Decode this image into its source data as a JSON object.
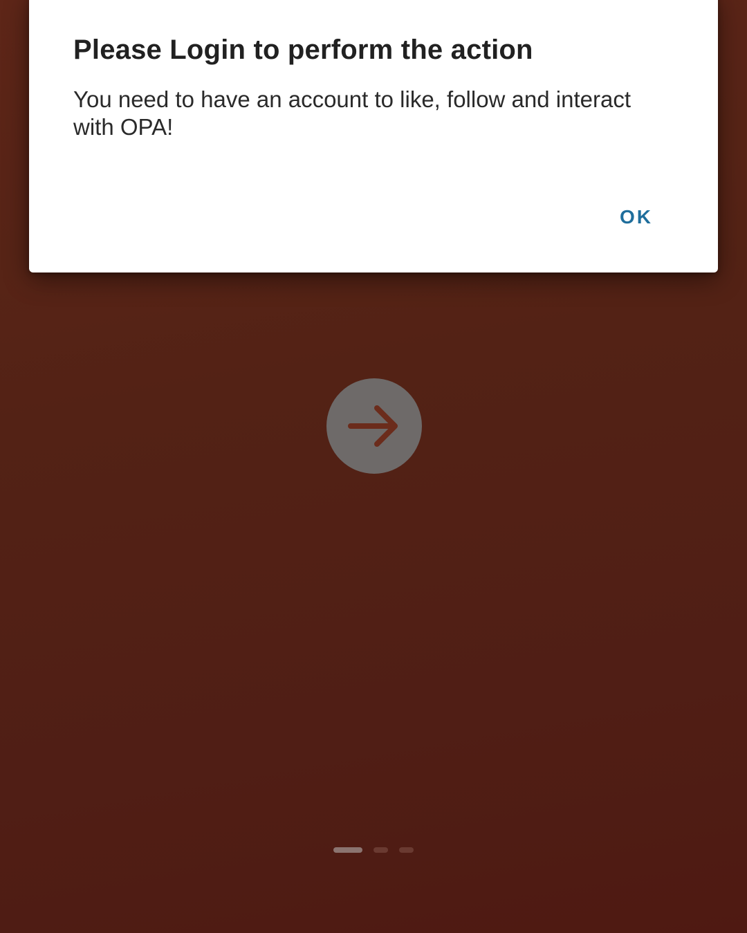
{
  "dialog": {
    "title": "Please Login to perform the action",
    "message": "You need to have an account to like, follow and interact with OPA!",
    "ok_label": "OK"
  },
  "background": {
    "next_icon": "arrow-right-icon"
  },
  "pager": {
    "total_pages": 3,
    "active_index": 0
  },
  "colors": {
    "accent": "#1f6e9c",
    "background": "#5f2719",
    "dialog": "#ffffff"
  }
}
